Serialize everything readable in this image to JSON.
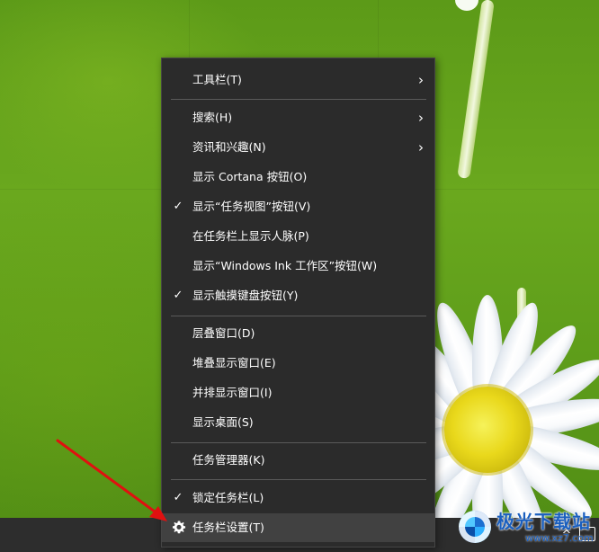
{
  "menu": {
    "items": [
      {
        "label": "工具栏(T)",
        "checked": false,
        "submenu": true
      },
      {
        "label": "搜索(H)",
        "checked": false,
        "submenu": true
      },
      {
        "label": "资讯和兴趣(N)",
        "checked": false,
        "submenu": true
      },
      {
        "label": "显示 Cortana 按钮(O)",
        "checked": false,
        "submenu": false
      },
      {
        "label": "显示“任务视图”按钮(V)",
        "checked": true,
        "submenu": false
      },
      {
        "label": "在任务栏上显示人脉(P)",
        "checked": false,
        "submenu": false
      },
      {
        "label": "显示“Windows Ink 工作区”按钮(W)",
        "checked": false,
        "submenu": false
      },
      {
        "label": "显示触摸键盘按钮(Y)",
        "checked": true,
        "submenu": false
      },
      {
        "label": "层叠窗口(D)",
        "checked": false,
        "submenu": false
      },
      {
        "label": "堆叠显示窗口(E)",
        "checked": false,
        "submenu": false
      },
      {
        "label": "并排显示窗口(I)",
        "checked": false,
        "submenu": false
      },
      {
        "label": "显示桌面(S)",
        "checked": false,
        "submenu": false
      },
      {
        "label": "任务管理器(K)",
        "checked": false,
        "submenu": false
      },
      {
        "label": "锁定任务栏(L)",
        "checked": true,
        "submenu": false
      },
      {
        "label": "任务栏设置(T)",
        "checked": false,
        "submenu": false,
        "icon": "gear-icon",
        "highlighted": true
      }
    ],
    "glyphs": {
      "check": "✓",
      "submenu_arrow": "›"
    },
    "colors": {
      "background": "#2b2b2b",
      "hover": "#414141",
      "text": "#ffffff",
      "separator": "#5a5a5a"
    }
  },
  "taskbar": {
    "color": "#2d2d2d",
    "tray_icons": [
      "chevron-up-icon",
      "touch-keyboard-icon"
    ],
    "chevron_glyph": "^"
  },
  "watermark": {
    "title": "极光下载站",
    "url": "www.xz7.com"
  },
  "annotation": {
    "arrow_color": "#e01010",
    "arrow_icon": "red-arrow-icon"
  }
}
